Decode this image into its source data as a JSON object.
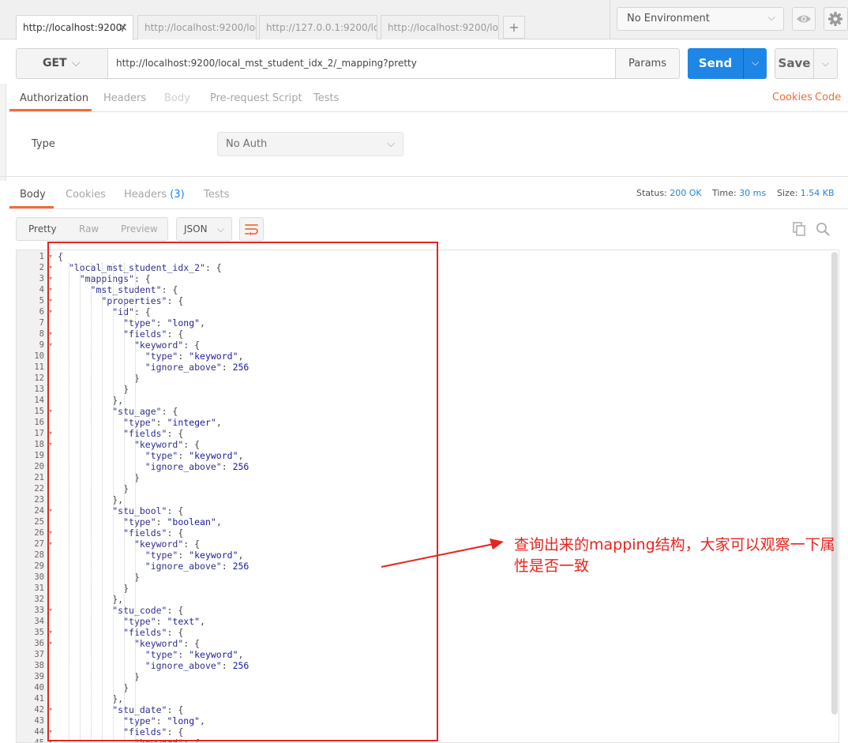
{
  "tabs": [
    {
      "label": "http://localhost:9200/",
      "active": true
    },
    {
      "label": "http://localhost:9200/local_m"
    },
    {
      "label": "http://127.0.0.1:9200/local_m"
    },
    {
      "label": "http://localhost:9200/local_m"
    }
  ],
  "tab_add": "+",
  "tab_close": "×",
  "environment": {
    "selected": "No Environment"
  },
  "request": {
    "method": "GET",
    "url": "http://localhost:9200/local_mst_student_idx_2/_mapping?pretty",
    "params_label": "Params",
    "send_label": "Send",
    "save_label": "Save"
  },
  "request_tabs": {
    "authorization": "Authorization",
    "headers": "Headers",
    "body": "Body",
    "prerequest": "Pre-request Script",
    "tests": "Tests",
    "cookies": "Cookies",
    "code": "Code"
  },
  "auth": {
    "type_label": "Type",
    "type_value": "No Auth"
  },
  "response_tabs": {
    "body": "Body",
    "cookies": "Cookies",
    "headers": "Headers",
    "headers_count": "(3)",
    "tests": "Tests"
  },
  "response_meta": {
    "status_label": "Status:",
    "status_value": "200 OK",
    "time_label": "Time:",
    "time_value": "30 ms",
    "size_label": "Size:",
    "size_value": "1.54 KB"
  },
  "view": {
    "pretty": "Pretty",
    "raw": "Raw",
    "preview": "Preview",
    "format": "JSON"
  },
  "code_lines": [
    "{",
    "  \"local_mst_student_idx_2\": {",
    "    \"mappings\": {",
    "      \"mst_student\": {",
    "        \"properties\": {",
    "          \"id\": {",
    "            \"type\": \"long\",",
    "            \"fields\": {",
    "              \"keyword\": {",
    "                \"type\": \"keyword\",",
    "                \"ignore_above\": 256",
    "              }",
    "            }",
    "          },",
    "          \"stu_age\": {",
    "            \"type\": \"integer\",",
    "            \"fields\": {",
    "              \"keyword\": {",
    "                \"type\": \"keyword\",",
    "                \"ignore_above\": 256",
    "              }",
    "            }",
    "          },",
    "          \"stu_bool\": {",
    "            \"type\": \"boolean\",",
    "            \"fields\": {",
    "              \"keyword\": {",
    "                \"type\": \"keyword\",",
    "                \"ignore_above\": 256",
    "              }",
    "            }",
    "          },",
    "          \"stu_code\": {",
    "            \"type\": \"text\",",
    "            \"fields\": {",
    "              \"keyword\": {",
    "                \"type\": \"keyword\",",
    "                \"ignore_above\": 256",
    "              }",
    "            }",
    "          },",
    "          \"stu_date\": {",
    "            \"type\": \"long\",",
    "            \"fields\": {",
    "              \"keyword\": {"
  ],
  "annotation": "查询出来的mapping结构，大家可以观察一下属性是否一致",
  "colors": {
    "accent": "#f26b3a",
    "send": "#1e86e5",
    "annotation": "#e8241d"
  }
}
